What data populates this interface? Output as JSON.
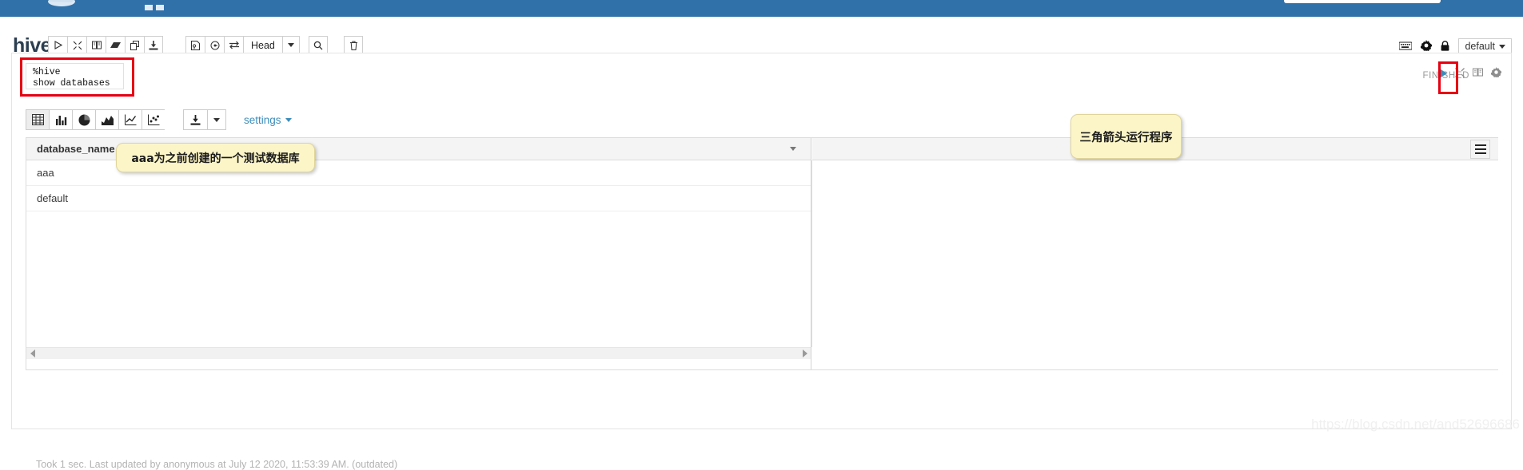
{
  "navbar": {
    "logo_icon": "zeppelin-bird-logo",
    "search_box": "",
    "dots_icon": "menu-dots-icon"
  },
  "notebook": {
    "title": "hive",
    "run_icon": "play-triangle-icon",
    "hide_icon": "collapse-arrows-icon",
    "book_icon": "show-hide-output-icon",
    "clear_icon": "eraser-icon",
    "clone_icon": "clone-note-icon",
    "export_icon": "export-note-icon",
    "version_icon": "version-control-icon",
    "schedule_icon": "cron-scheduler-icon",
    "shortcut_icon": "swap-icon",
    "head_label": "Head",
    "head_caret_icon": "chevron-down-icon",
    "search_icon": "search-icon",
    "trash_icon": "trash-icon",
    "keyboard_icon": "keyboard-icon",
    "gear_icon": "gear-icon",
    "lock_icon": "lock-icon",
    "interpreter_binding": "default",
    "interpreter_caret_icon": "chevron-down-icon"
  },
  "paragraph": {
    "code_line_1": "%hive",
    "code_line_2": "show databases",
    "status": "FINISHED",
    "run_icon": "play-triangle-icon",
    "minimize_icon": "collapse-arrows-icon",
    "book_icon": "show-output-icon",
    "gear_icon": "gear-icon",
    "highlight_color": "#e60012"
  },
  "viz_toolbar": {
    "buttons": [
      {
        "name": "table-chart-button",
        "icon": "table-icon",
        "active": true
      },
      {
        "name": "bar-chart-button",
        "icon": "bar-chart-icon",
        "active": false
      },
      {
        "name": "pie-chart-button",
        "icon": "pie-chart-icon",
        "active": false
      },
      {
        "name": "area-chart-button",
        "icon": "area-chart-icon",
        "active": false
      },
      {
        "name": "line-chart-button",
        "icon": "line-chart-icon",
        "active": false
      },
      {
        "name": "scatter-chart-button",
        "icon": "scatter-chart-icon",
        "active": false
      }
    ],
    "download_icon": "download-icon",
    "download_caret_icon": "chevron-down-icon",
    "settings_label": "settings",
    "settings_caret_icon": "chevron-down-icon"
  },
  "result_table": {
    "columns": [
      "database_name"
    ],
    "rows": [
      [
        "aaa"
      ],
      [
        "default"
      ]
    ],
    "header_caret_icon": "chevron-down-icon",
    "menu_icon": "hamburger-menu-icon",
    "scrollbar_up_icon": "triangle-up-icon",
    "scrollbar_down_icon": "triangle-down-icon",
    "scrollbar_left_icon": "triangle-left-icon",
    "scrollbar_right_icon": "triangle-right-icon"
  },
  "footer": {
    "status_text": "Took 1 sec. Last updated by anonymous at July 12 2020, 11:53:39 AM. (outdated)",
    "watermark": "https://blog.csdn.net/and52696686"
  },
  "annotations": [
    {
      "name": "annotation-aaa-database",
      "text": "aaa为之前创建的一个测试数据库"
    },
    {
      "name": "annotation-run-triangle",
      "text": "三角箭头运行程序"
    }
  ],
  "colors": {
    "navbar_blue": "#3071a9",
    "accent_blue": "#3c8dbc",
    "highlight_red": "#e60012",
    "note_yellow": "#fcf5c7"
  }
}
